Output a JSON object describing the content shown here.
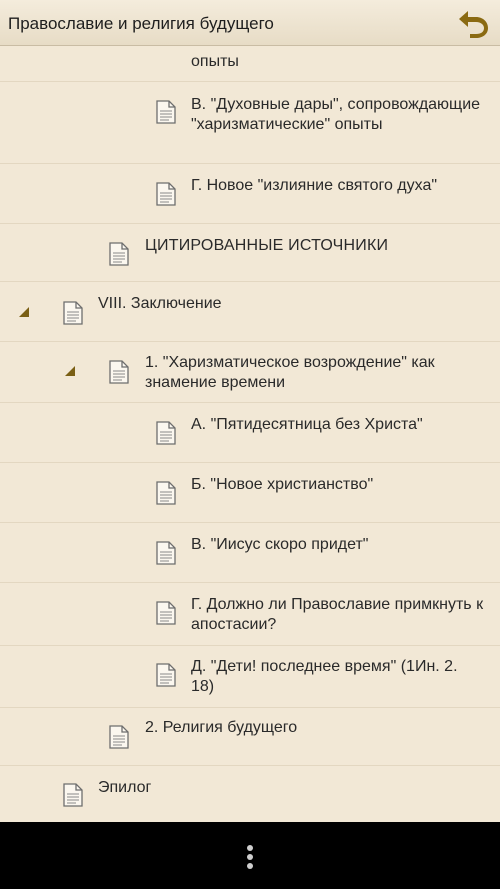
{
  "header": {
    "title": "Православие и религия будущего",
    "back_icon": "back-arrow-icon"
  },
  "list": {
    "items": [
      {
        "label": "опыты"
      },
      {
        "label": "В. \"Духовные дары\", сопровождающие \"харизматические\" опыты"
      },
      {
        "label": "Г. Новое \"излияние святого духа\""
      },
      {
        "label": "ЦИТИРОВАННЫЕ ИСТОЧНИКИ"
      },
      {
        "label": "VIII. Заключение"
      },
      {
        "label": "1. \"Харизматическое возрождение\" как знамение времени"
      },
      {
        "label": "А. \"Пятидесятница без Христа\""
      },
      {
        "label": "Б. \"Новое христианство\""
      },
      {
        "label": "В. \"Иисус скоро придет\""
      },
      {
        "label": "Г. Должно ли Православие примкнуть к апостасии?"
      },
      {
        "label": "Д. \"Дети! последнее время\" (1Ин. 2. 18)"
      },
      {
        "label": "2. Религия будущего"
      },
      {
        "label": "Эпилог"
      }
    ]
  },
  "navbar": {
    "menu_icon": "overflow-menu-icon"
  },
  "colors": {
    "background": "#f2e8d6",
    "accent": "#8a6a12",
    "navbar": "#000000"
  }
}
